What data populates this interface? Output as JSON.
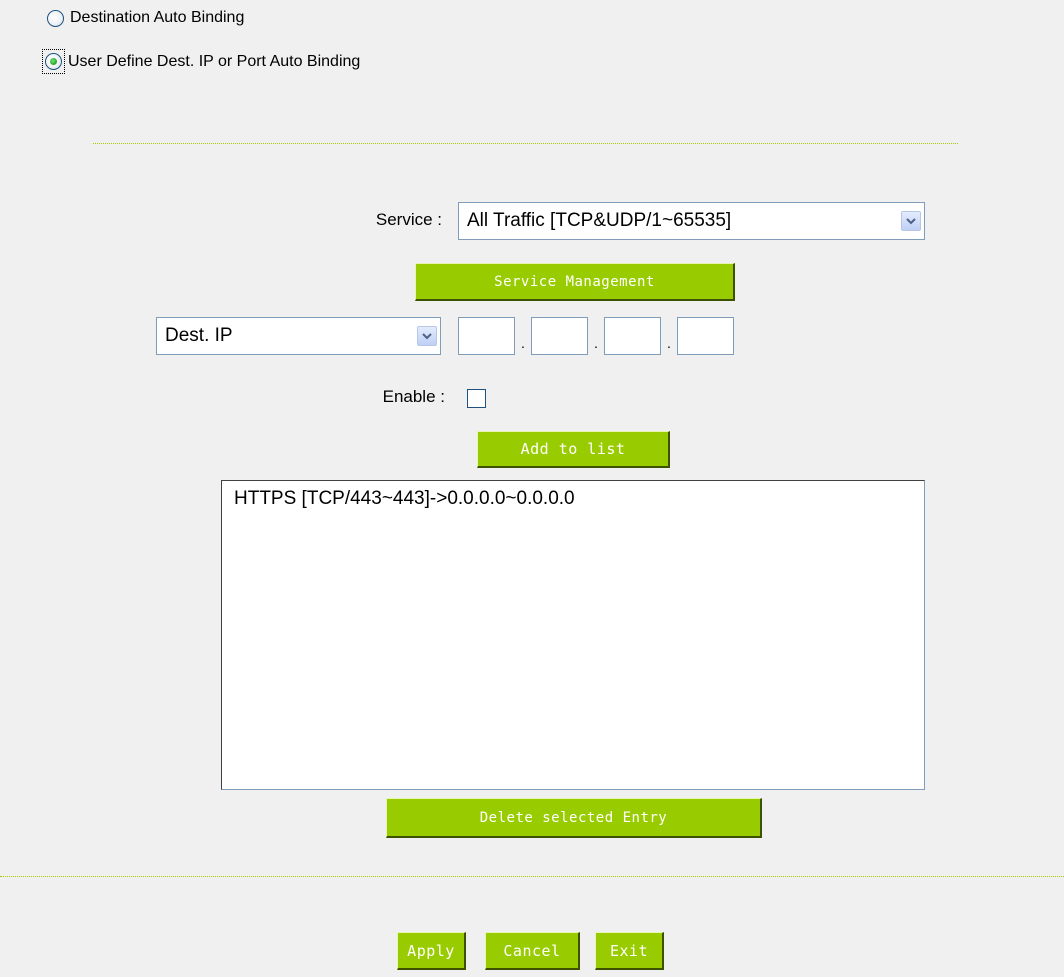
{
  "binding_mode": {
    "options": [
      {
        "label": "Destination Auto Binding",
        "selected": false
      },
      {
        "label": "User Define Dest. IP or Port Auto Binding",
        "selected": true
      }
    ]
  },
  "service": {
    "label": "Service :",
    "value": "All Traffic [TCP&UDP/1~65535]"
  },
  "service_management_button": "Service Management",
  "dest_type": {
    "value": "Dest. IP"
  },
  "ip_octets": [
    "",
    "",
    "",
    ""
  ],
  "enable": {
    "label": "Enable :",
    "checked": false
  },
  "add_to_list_button": "Add to list",
  "entries": [
    "HTTPS [TCP/443~443]->0.0.0.0~0.0.0.0"
  ],
  "delete_button": "Delete selected Entry",
  "footer": {
    "apply": "Apply",
    "cancel": "Cancel",
    "exit": "Exit"
  },
  "colors": {
    "button_green": "#99cc00",
    "divider": "#a8c800",
    "background": "#f0f0f0"
  }
}
